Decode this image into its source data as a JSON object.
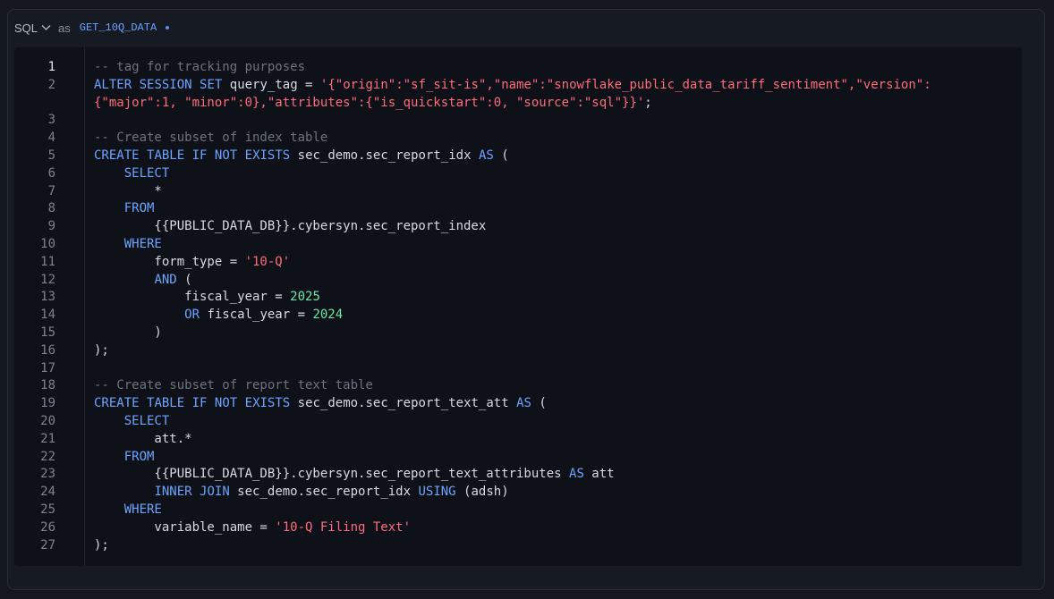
{
  "header": {
    "language": "SQL",
    "as_word": "as",
    "result_name": "GET_10Q_DATA"
  },
  "editor": {
    "active_line": 1,
    "lines": [
      {
        "num": "1",
        "tokens": [
          [
            "c",
            "-- tag for tracking purposes"
          ]
        ]
      },
      {
        "num": "2",
        "tokens": [
          [
            "k",
            "ALTER"
          ],
          [
            "p",
            " "
          ],
          [
            "k",
            "SESSION"
          ],
          [
            "p",
            " "
          ],
          [
            "k",
            "SET"
          ],
          [
            "p",
            " query_tag = "
          ],
          [
            "s",
            "'{\"origin\":\"sf_sit-is\",\"name\":\"snowflake_public_data_tariff_sentiment\",\"version\":"
          ]
        ]
      },
      {
        "num": "",
        "tokens": [
          [
            "s",
            "{\"major\":1, \"minor\":0},\"attributes\":{\"is_quickstart\":0, \"source\":\"sql\"}}'"
          ],
          [
            "p",
            ";"
          ]
        ]
      },
      {
        "num": "3",
        "tokens": []
      },
      {
        "num": "4",
        "tokens": [
          [
            "c",
            "-- Create subset of index table"
          ]
        ]
      },
      {
        "num": "5",
        "tokens": [
          [
            "k",
            "CREATE"
          ],
          [
            "p",
            " "
          ],
          [
            "k",
            "TABLE"
          ],
          [
            "p",
            " "
          ],
          [
            "k",
            "IF"
          ],
          [
            "p",
            " "
          ],
          [
            "k",
            "NOT"
          ],
          [
            "p",
            " "
          ],
          [
            "k",
            "EXISTS"
          ],
          [
            "p",
            " sec_demo.sec_report_idx "
          ],
          [
            "k",
            "AS"
          ],
          [
            "p",
            " ("
          ]
        ]
      },
      {
        "num": "6",
        "tokens": [
          [
            "p",
            "    "
          ],
          [
            "k",
            "SELECT"
          ]
        ]
      },
      {
        "num": "7",
        "tokens": [
          [
            "p",
            "        *"
          ]
        ]
      },
      {
        "num": "8",
        "tokens": [
          [
            "p",
            "    "
          ],
          [
            "k",
            "FROM"
          ]
        ]
      },
      {
        "num": "9",
        "tokens": [
          [
            "p",
            "        {{PUBLIC_DATA_DB}}.cybersyn.sec_report_index"
          ]
        ]
      },
      {
        "num": "10",
        "tokens": [
          [
            "p",
            "    "
          ],
          [
            "k",
            "WHERE"
          ]
        ]
      },
      {
        "num": "11",
        "tokens": [
          [
            "p",
            "        form_type = "
          ],
          [
            "s",
            "'10-Q'"
          ]
        ]
      },
      {
        "num": "12",
        "tokens": [
          [
            "p",
            "        "
          ],
          [
            "k",
            "AND"
          ],
          [
            "p",
            " ("
          ]
        ]
      },
      {
        "num": "13",
        "tokens": [
          [
            "p",
            "            fiscal_year = "
          ],
          [
            "n",
            "2025"
          ]
        ]
      },
      {
        "num": "14",
        "tokens": [
          [
            "p",
            "            "
          ],
          [
            "k",
            "OR"
          ],
          [
            "p",
            " fiscal_year = "
          ],
          [
            "n",
            "2024"
          ]
        ]
      },
      {
        "num": "15",
        "tokens": [
          [
            "p",
            "        )"
          ]
        ]
      },
      {
        "num": "16",
        "tokens": [
          [
            "p",
            ");"
          ]
        ]
      },
      {
        "num": "17",
        "tokens": []
      },
      {
        "num": "18",
        "tokens": [
          [
            "c",
            "-- Create subset of report text table"
          ]
        ]
      },
      {
        "num": "19",
        "tokens": [
          [
            "k",
            "CREATE"
          ],
          [
            "p",
            " "
          ],
          [
            "k",
            "TABLE"
          ],
          [
            "p",
            " "
          ],
          [
            "k",
            "IF"
          ],
          [
            "p",
            " "
          ],
          [
            "k",
            "NOT"
          ],
          [
            "p",
            " "
          ],
          [
            "k",
            "EXISTS"
          ],
          [
            "p",
            " sec_demo.sec_report_text_att "
          ],
          [
            "k",
            "AS"
          ],
          [
            "p",
            " ("
          ]
        ]
      },
      {
        "num": "20",
        "tokens": [
          [
            "p",
            "    "
          ],
          [
            "k",
            "SELECT"
          ]
        ]
      },
      {
        "num": "21",
        "tokens": [
          [
            "p",
            "        att.*"
          ]
        ]
      },
      {
        "num": "22",
        "tokens": [
          [
            "p",
            "    "
          ],
          [
            "k",
            "FROM"
          ]
        ]
      },
      {
        "num": "23",
        "tokens": [
          [
            "p",
            "        {{PUBLIC_DATA_DB}}.cybersyn.sec_report_text_attributes "
          ],
          [
            "k",
            "AS"
          ],
          [
            "p",
            " att"
          ]
        ]
      },
      {
        "num": "24",
        "tokens": [
          [
            "p",
            "        "
          ],
          [
            "k",
            "INNER"
          ],
          [
            "p",
            " "
          ],
          [
            "k",
            "JOIN"
          ],
          [
            "p",
            " sec_demo.sec_report_idx "
          ],
          [
            "k",
            "USING"
          ],
          [
            "p",
            " (adsh)"
          ]
        ]
      },
      {
        "num": "25",
        "tokens": [
          [
            "p",
            "    "
          ],
          [
            "k",
            "WHERE"
          ]
        ]
      },
      {
        "num": "26",
        "tokens": [
          [
            "p",
            "        variable_name = "
          ],
          [
            "s",
            "'10-Q Filing Text'"
          ]
        ]
      },
      {
        "num": "27",
        "tokens": [
          [
            "p",
            ");"
          ]
        ]
      }
    ]
  }
}
